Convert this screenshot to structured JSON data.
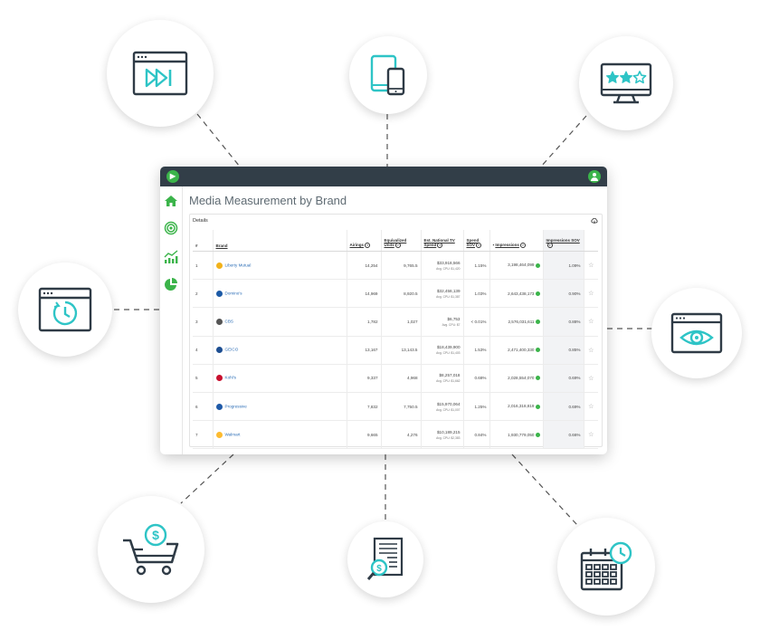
{
  "app": {
    "logo_glyph": "▶",
    "page_title": "Media Measurement by Brand",
    "details_label": "Details"
  },
  "columns": {
    "index": "#",
    "brand": "Brand",
    "airings": "Airings",
    "equivalized_units": "Equivalized Units",
    "est_national_tv_spend": "Est. National TV Spend",
    "spend_sov": "Spend SOV",
    "impressions": "Impressions",
    "impressions_sov": "Impressions SOV",
    "sort_marker": "▪"
  },
  "rows": [
    {
      "n": "1",
      "brand": "Liberty Mutual",
      "airings": "14,254",
      "eq_units": "9,765.5",
      "spend": "$33,918,566",
      "cpu": "Avg. CPU: $1,420",
      "spend_sov": "1.15%",
      "impressions": "3,198,464,099",
      "imp_sov": "1.09%",
      "star": "☆"
    },
    {
      "n": "2",
      "brand": "Domino's",
      "airings": "14,969",
      "eq_units": "8,920.5",
      "spend": "$32,458,139",
      "cpu": "Avg. CPU: $1,387",
      "spend_sov": "1.03%",
      "impressions": "2,643,438,173",
      "imp_sov": "0.90%",
      "star": "☆"
    },
    {
      "n": "3",
      "brand": "CBS",
      "airings": "1,782",
      "eq_units": "1,027",
      "spend": "$6,753",
      "cpu": "Avg. CPU: $7",
      "spend_sov": "< 0.01%",
      "impressions": "2,576,031,611",
      "imp_sov": "0.88%",
      "star": "☆"
    },
    {
      "n": "4",
      "brand": "GEICO",
      "airings": "13,167",
      "eq_units": "13,143.5",
      "spend": "$18,439,900",
      "cpu": "Avg. CPU: $1,403",
      "spend_sov": "1.53%",
      "impressions": "2,471,400,330",
      "imp_sov": "0.85%",
      "star": "☆"
    },
    {
      "n": "5",
      "brand": "Kohl's",
      "airings": "9,337",
      "eq_units": "4,968",
      "spend": "$8,257,018",
      "cpu": "Avg. CPU: $1,662",
      "spend_sov": "0.68%",
      "impressions": "2,028,554,070",
      "imp_sov": "0.69%",
      "star": "☆"
    },
    {
      "n": "6",
      "brand": "Progressive",
      "airings": "7,832",
      "eq_units": "7,750.5",
      "spend": "$15,970,064",
      "cpu": "Avg. CPU: $1,007",
      "spend_sov": "1.25%",
      "impressions": "2,016,318,819",
      "imp_sov": "0.69%",
      "star": "☆"
    },
    {
      "n": "7",
      "brand": "Walmart",
      "airings": "9,665",
      "eq_units": "4,276",
      "spend": "$10,189,215",
      "cpu": "Avg. CPU: $2,383",
      "spend_sov": "0.84%",
      "impressions": "1,930,779,050",
      "imp_sov": "0.66%",
      "star": "☆"
    }
  ],
  "icons": {
    "top_left": "fast-forward-window-icon",
    "top_center": "tablet-phone-icon",
    "top_right": "star-rating-monitor-icon",
    "left": "timer-window-icon",
    "right": "eye-window-icon",
    "bottom_left": "dollar-shopping-cart-icon",
    "bottom_center": "invoice-magnifier-icon",
    "bottom_right": "calendar-clock-icon"
  },
  "colors": {
    "accent": "#3bb44a",
    "icon_teal": "#2ec4c6",
    "icon_dark": "#2f3b46",
    "topbar": "#323e48",
    "link": "#2e6fb7"
  }
}
